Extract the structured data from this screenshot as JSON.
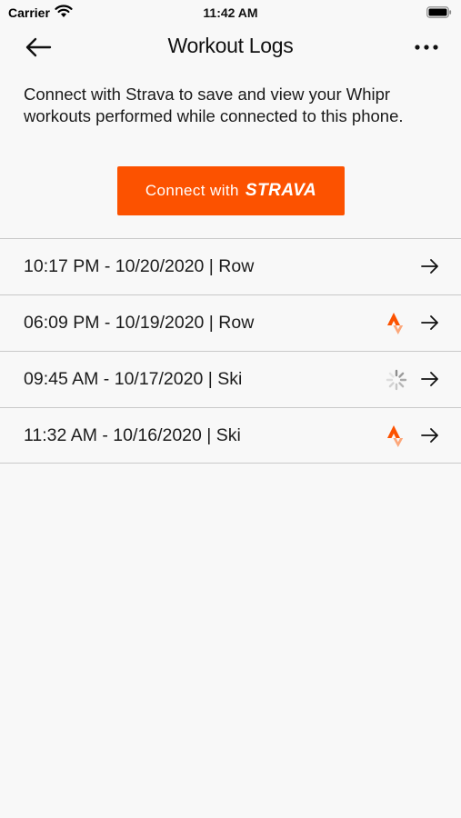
{
  "status_bar": {
    "carrier": "Carrier",
    "time": "11:42 AM"
  },
  "nav": {
    "title": "Workout Logs",
    "back_icon": "arrow-left-icon",
    "more_icon": "ellipsis-icon"
  },
  "intro": {
    "text": "Connect with Strava to save and view your Whipr workouts performed while connected to this phone."
  },
  "connect_button": {
    "label": "Connect with",
    "brand": "STRAVA",
    "color": "#fc5200"
  },
  "logs": [
    {
      "label": "10:17 PM - 10/20/2020 | Row",
      "sync_status": "none"
    },
    {
      "label": "06:09 PM - 10/19/2020 | Row",
      "sync_status": "synced",
      "sync_icon": "strava-logo-icon"
    },
    {
      "label": "09:45 AM - 10/17/2020 | Ski",
      "sync_status": "syncing",
      "sync_icon": "spinner-icon"
    },
    {
      "label": "11:32 AM - 10/16/2020 | Ski",
      "sync_status": "synced",
      "sync_icon": "strava-logo-icon"
    }
  ]
}
